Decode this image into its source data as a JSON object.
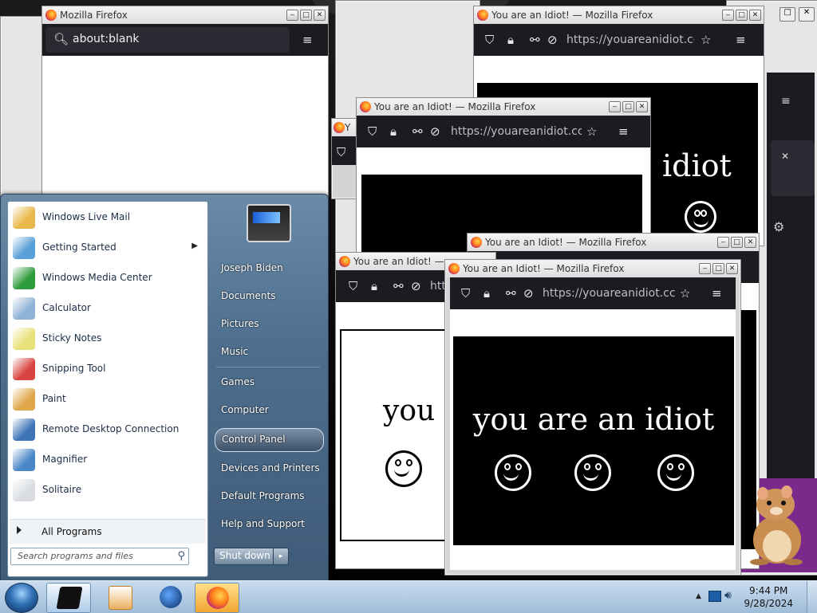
{
  "colors": {
    "firefox_nav": "#1c1b22",
    "taskbar": "#b8d0e8",
    "startmenu": "#4d6e8d"
  },
  "windows": {
    "blank": {
      "title": "Mozilla Firefox",
      "url": "about:blank"
    },
    "idiot": {
      "title": "You are an Idiot! — Mozilla Firefox",
      "title_short": "You are an Idiot! —",
      "title_y": "Y",
      "url": "https://youareanidiot.cc/lol.",
      "url_short": "htt",
      "big_text": "you are an idiot",
      "big_text_part": "you a",
      "big_text_tail": "idiot",
      "text_color": "#ffffff"
    }
  },
  "window_buttons": {
    "min": "‒",
    "max": "□",
    "close": "✕"
  },
  "icons": {
    "search": "search-icon",
    "menu": "hamburger-menu-icon",
    "shield": "shield-icon",
    "lock": "lock-icon",
    "permissions": "permissions-icon",
    "tracking": "tracking-off-icon",
    "star": "bookmark-star-icon",
    "close": "close-icon",
    "gear": "gear-icon"
  },
  "start_menu": {
    "pinned": [
      {
        "label": "Windows Live Mail",
        "icon": "mail-icon",
        "color": "#e9b84a"
      },
      {
        "label": "Getting Started",
        "icon": "getting-started-icon",
        "color": "#5aa0d8",
        "submenu": true
      },
      {
        "label": "Windows Media Center",
        "icon": "media-center-icon",
        "color": "#2e9b3c"
      },
      {
        "label": "Calculator",
        "icon": "calculator-icon",
        "color": "#8fb3d6"
      },
      {
        "label": "Sticky Notes",
        "icon": "sticky-notes-icon",
        "color": "#e8e27a"
      },
      {
        "label": "Snipping Tool",
        "icon": "snipping-tool-icon",
        "color": "#d8443f"
      },
      {
        "label": "Paint",
        "icon": "paint-icon",
        "color": "#e0a74a"
      },
      {
        "label": "Remote Desktop Connection",
        "icon": "remote-desktop-icon",
        "color": "#3d74b8"
      },
      {
        "label": "Magnifier",
        "icon": "magnifier-icon",
        "color": "#4a86c8"
      },
      {
        "label": "Solitaire",
        "icon": "solitaire-icon",
        "color": "#d9dde2"
      }
    ],
    "all_programs": "All Programs",
    "search_placeholder": "Search programs and files",
    "right": [
      {
        "label": "Joseph Biden"
      },
      {
        "label": "Documents"
      },
      {
        "label": "Pictures"
      },
      {
        "label": "Music"
      },
      {
        "label": "Games"
      },
      {
        "label": "Computer"
      },
      {
        "label": "Control Panel"
      },
      {
        "label": "Devices and Printers"
      },
      {
        "label": "Default Programs"
      },
      {
        "label": "Help and Support"
      }
    ],
    "shutdown": "Shut down",
    "shutdown_arrow": "▸"
  },
  "taskbar": {
    "buttons": [
      {
        "name": "tablet-app-icon",
        "active": true
      },
      {
        "name": "media-player-icon",
        "active": false
      },
      {
        "name": "internet-explorer-icon",
        "active": false
      },
      {
        "name": "firefox-icon",
        "active": true
      }
    ],
    "time": "9:44 PM",
    "date": "9/28/2024"
  }
}
